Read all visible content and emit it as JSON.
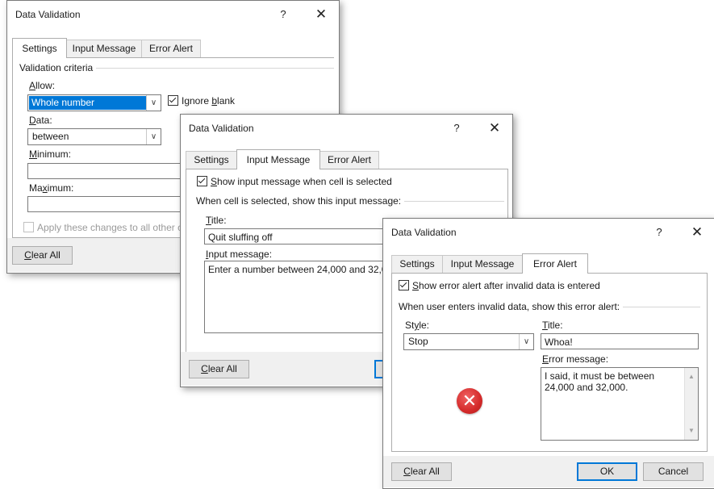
{
  "dialog1": {
    "title": "Data Validation",
    "help": "?",
    "close": "✕",
    "tabs": [
      "Settings",
      "Input Message",
      "Error Alert"
    ],
    "group_title": "Validation criteria",
    "allow_label_pre": "",
    "allow_label_ul": "A",
    "allow_label_post": "llow:",
    "allow_value": "Whole number",
    "ignore_blank_pre": "Ignore ",
    "ignore_blank_ul": "b",
    "ignore_blank_post": "lank",
    "ignore_blank_checked": true,
    "data_label_ul": "D",
    "data_label_post": "ata:",
    "data_value": "between",
    "minimum_label_ul": "M",
    "minimum_label_post": "inimum:",
    "minimum_value": "",
    "maximum_label_pre": "Ma",
    "maximum_label_ul": "x",
    "maximum_label_post": "imum:",
    "maximum_value": "",
    "apply_changes": "Apply these changes to all other c",
    "clear_all_ul": "C",
    "clear_all_post": "lear All"
  },
  "dialog2": {
    "title": "Data Validation",
    "help": "?",
    "close": "✕",
    "tabs": [
      "Settings",
      "Input Message",
      "Error Alert"
    ],
    "show_msg_ul": "S",
    "show_msg_post": "how input message when cell is selected",
    "show_msg_checked": true,
    "group_title": "When cell is selected, show this input message:",
    "title_label_ul": "T",
    "title_label_post": "itle:",
    "title_value": "Quit sluffing off",
    "input_msg_ul": "I",
    "input_msg_post": "nput message:",
    "input_msg_value": "Enter a number between 24,000 and 32,0",
    "clear_all_ul": "C",
    "clear_all_post": "lear All"
  },
  "dialog3": {
    "title": "Data Validation",
    "help": "?",
    "close": "✕",
    "tabs": [
      "Settings",
      "Input Message",
      "Error Alert"
    ],
    "show_err_ul": "S",
    "show_err_post": "how error alert after invalid data is entered",
    "show_err_checked": true,
    "group_title": "When user enters invalid data, show this error alert:",
    "style_label_pre": "St",
    "style_label_ul": "y",
    "style_label_post": "le:",
    "style_value": "Stop",
    "title_label_ul": "T",
    "title_label_post": "itle:",
    "title_value": "Whoa!",
    "error_msg_ul": "E",
    "error_msg_post": "rror message:",
    "error_msg_value": "I said, it must be between 24,000 and 32,000.",
    "stop_icon_glyph": "✕",
    "clear_all_ul": "C",
    "clear_all_post": "lear All",
    "ok_label": "OK",
    "cancel_label": "Cancel"
  },
  "colors": {
    "selection": "#0078d7",
    "stop_icon": "#d42a2a",
    "footer": "#f0f0f0"
  }
}
